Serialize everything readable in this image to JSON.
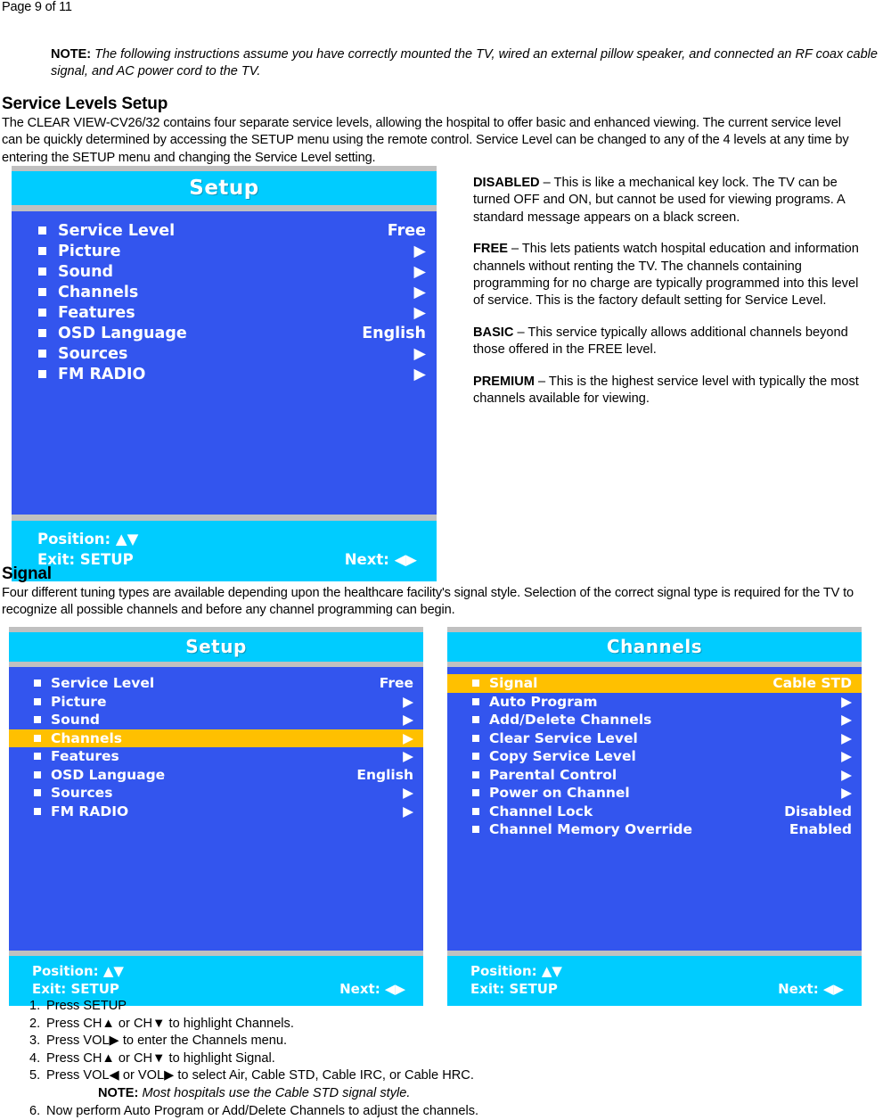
{
  "page": {
    "header": "Page 9 of 11"
  },
  "note_top": {
    "label": "NOTE:",
    "text": "The following instructions assume you have correctly mounted the TV, wired an external pillow speaker, and connected an RF coax cable signal, and AC power cord to the TV."
  },
  "sections": {
    "service_levels": {
      "heading": "Service Levels Setup",
      "paragraph": "The CLEAR VIEW-CV26/32 contains four separate service levels, allowing the hospital to offer basic and enhanced viewing.  The current service level can be quickly determined by accessing the SETUP menu using the remote control.  Service Level can be changed to any of the 4 levels at any time by entering the SETUP menu and changing the Service Level setting."
    },
    "signal": {
      "heading": "Signal",
      "paragraph": "Four different tuning types are available depending upon the healthcare facility's signal style. Selection of the correct signal type is required for the TV to recognize all possible channels and before any channel programming can begin."
    }
  },
  "service_level_descriptions": [
    {
      "term": "DISABLED",
      "text": " – This is like a mechanical key lock. The TV can be turned OFF and ON, but cannot be used for viewing programs.  A standard message appears on a black screen."
    },
    {
      "term": "FREE",
      "text": " – This lets patients watch hospital education and information channels without renting the TV.  The channels containing programming for no charge are typically programmed into this level of service.  This is the factory default setting for Service Level."
    },
    {
      "term": "BASIC",
      "text": " – This service typically allows additional channels beyond those offered in the FREE level."
    },
    {
      "term": "PREMIUM",
      "text": " – This is the highest service level with typically the most channels available for viewing."
    }
  ],
  "osd_colors": {
    "bezel": "#c0c0c0",
    "title_bar": "#00ccff",
    "body": "#3355ee",
    "highlight": "#ffc000",
    "text": "#ffffff"
  },
  "osd_setup_1": {
    "title": "Setup",
    "items": [
      {
        "label": "Service Level",
        "value": "Free",
        "arrow": "",
        "selected": true
      },
      {
        "label": "Picture",
        "value": "",
        "arrow": "▶",
        "selected": false
      },
      {
        "label": "Sound",
        "value": "",
        "arrow": "▶",
        "selected": false
      },
      {
        "label": "Channels",
        "value": "",
        "arrow": "▶",
        "selected": false
      },
      {
        "label": "Features",
        "value": "",
        "arrow": "▶",
        "selected": false
      },
      {
        "label": "OSD Language",
        "value": "English",
        "arrow": "",
        "selected": false
      },
      {
        "label": "Sources",
        "value": "",
        "arrow": "▶",
        "selected": false
      },
      {
        "label": "FM RADIO",
        "value": "",
        "arrow": "▶",
        "selected": false
      }
    ],
    "footer": {
      "position": "Position: ▲▼",
      "exit": "Exit: SETUP",
      "next": "Next: ◀▶"
    }
  },
  "osd_setup_2": {
    "title": "Setup",
    "items": [
      {
        "label": "Service Level",
        "value": "Free",
        "arrow": "",
        "selected": false
      },
      {
        "label": "Picture",
        "value": "",
        "arrow": "▶",
        "selected": false
      },
      {
        "label": "Sound",
        "value": "",
        "arrow": "▶",
        "selected": false
      },
      {
        "label": "Channels",
        "value": "",
        "arrow": "▶",
        "selected": true
      },
      {
        "label": "Features",
        "value": "",
        "arrow": "▶",
        "selected": false
      },
      {
        "label": "OSD Language",
        "value": "English",
        "arrow": "",
        "selected": false
      },
      {
        "label": "Sources",
        "value": "",
        "arrow": "▶",
        "selected": false
      },
      {
        "label": "FM RADIO",
        "value": "",
        "arrow": "▶",
        "selected": false
      }
    ],
    "footer": {
      "position": "Position: ▲▼",
      "exit": "Exit: SETUP",
      "next": "Next: ◀▶"
    }
  },
  "osd_channels": {
    "title": "Channels",
    "items": [
      {
        "label": "Signal",
        "value": "Cable STD",
        "arrow": "",
        "selected": true
      },
      {
        "label": "Auto Program",
        "value": "",
        "arrow": "▶",
        "selected": false
      },
      {
        "label": "Add/Delete Channels",
        "value": "",
        "arrow": "▶",
        "selected": false
      },
      {
        "label": "Clear Service Level",
        "value": "",
        "arrow": "▶",
        "selected": false
      },
      {
        "label": "Copy Service Level",
        "value": "",
        "arrow": "▶",
        "selected": false
      },
      {
        "label": "Parental Control",
        "value": "",
        "arrow": "▶",
        "selected": false
      },
      {
        "label": "Power on Channel",
        "value": "",
        "arrow": "▶",
        "selected": false
      },
      {
        "label": "Channel Lock",
        "value": "Disabled",
        "arrow": "",
        "selected": false
      },
      {
        "label": "Channel Memory Override",
        "value": "Enabled",
        "arrow": "",
        "selected": false
      }
    ],
    "footer": {
      "position": "Position: ▲▼",
      "exit": "Exit: SETUP",
      "next": "Next: ◀▶"
    }
  },
  "steps": [
    {
      "num": "1.",
      "text": "Press SETUP"
    },
    {
      "num": "2.",
      "text": "Press CH▲ or CH▼ to highlight Channels."
    },
    {
      "num": "3.",
      "text": "Press VOL▶ to enter the Channels menu."
    },
    {
      "num": "4.",
      "text": "Press CH▲ or CH▼ to highlight Signal."
    },
    {
      "num": "5.",
      "text": "Press VOL◀ or VOL▶ to select Air, Cable STD, Cable IRC, or Cable HRC."
    },
    {
      "num": "6.",
      "text": "Now perform Auto Program or Add/Delete Channels to adjust the channels."
    }
  ],
  "step_note": {
    "label": "NOTE:",
    "text": "Most hospitals use the Cable STD signal style."
  }
}
